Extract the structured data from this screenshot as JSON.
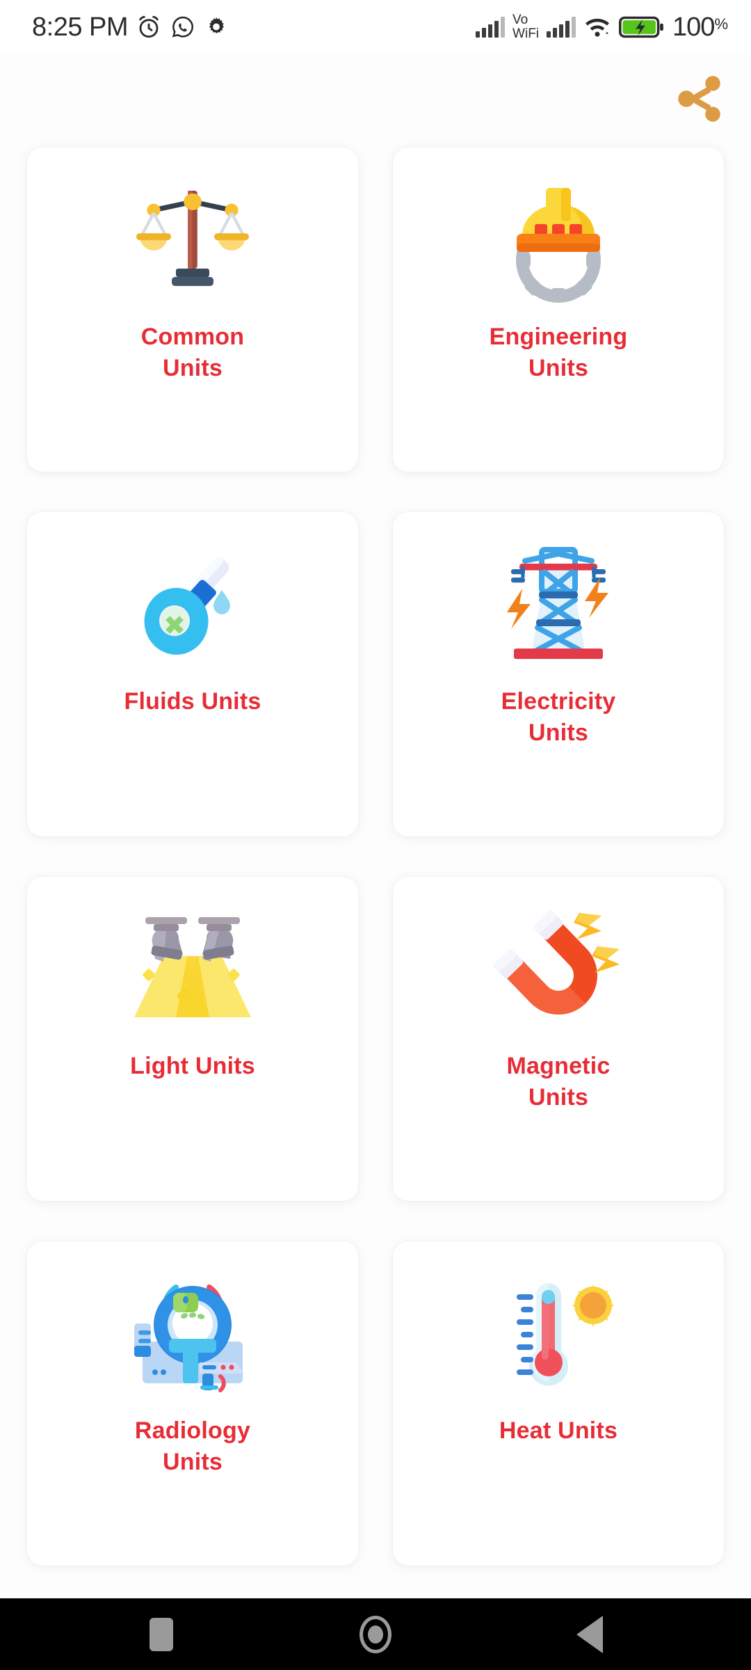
{
  "status_bar": {
    "time": "8:25 PM",
    "left_icons": [
      "alarm-clock-icon",
      "whatsapp-icon",
      "gear-icon"
    ],
    "network_label": "Vo\nWiFi",
    "network_label_line1": "Vo",
    "network_label_line2": "WiFi",
    "right_icons": [
      "signal-bars-icon",
      "vowifi-label",
      "signal-bars-icon-2",
      "wifi-icon",
      "battery-charging-icon"
    ],
    "battery_percent": "100",
    "battery_percent_suffix": "%",
    "battery_color": "#55C51C"
  },
  "header": {
    "share_icon": "share-icon",
    "share_icon_color": "#DD9B45"
  },
  "theme": {
    "label_color": "#E82C36",
    "card_background": "#FFFFFF",
    "page_background": "#FDFDFD",
    "navbar_background": "#000000",
    "navbar_icon_color": "#9A9A9A"
  },
  "grid": {
    "columns": 2,
    "cards": [
      {
        "id": "common-units",
        "label": "Common\nUnits",
        "line1": "Common",
        "line2": "Units",
        "icon": "balance-scale-icon"
      },
      {
        "id": "engineering-units",
        "label": "Engineering\nUnits",
        "line1": "Engineering",
        "line2": "Units",
        "icon": "hard-hat-gear-icon"
      },
      {
        "id": "fluids-units",
        "label": "Fluids Units",
        "line1": "Fluids Units",
        "line2": "",
        "icon": "dropper-bulb-icon"
      },
      {
        "id": "electricity-units",
        "label": "Electricity\nUnits",
        "line1": "Electricity",
        "line2": "Units",
        "icon": "power-pylon-icon"
      },
      {
        "id": "light-units",
        "label": "Light Units",
        "line1": "Light Units",
        "line2": "",
        "icon": "spotlights-icon"
      },
      {
        "id": "magnetic-units",
        "label": "Magnetic\nUnits",
        "line1": "Magnetic",
        "line2": "Units",
        "icon": "horseshoe-magnet-icon"
      },
      {
        "id": "radiology-units",
        "label": "Radiology\nUnits",
        "line1": "Radiology",
        "line2": "Units",
        "icon": "mri-scanner-icon"
      },
      {
        "id": "heat-units",
        "label": "Heat Units",
        "line1": "Heat Units",
        "line2": "",
        "icon": "thermometer-sun-icon"
      }
    ]
  },
  "nav_bar": {
    "buttons": [
      {
        "id": "recents",
        "icon": "square-recents-icon"
      },
      {
        "id": "home",
        "icon": "circle-home-icon"
      },
      {
        "id": "back",
        "icon": "triangle-back-icon"
      }
    ]
  }
}
